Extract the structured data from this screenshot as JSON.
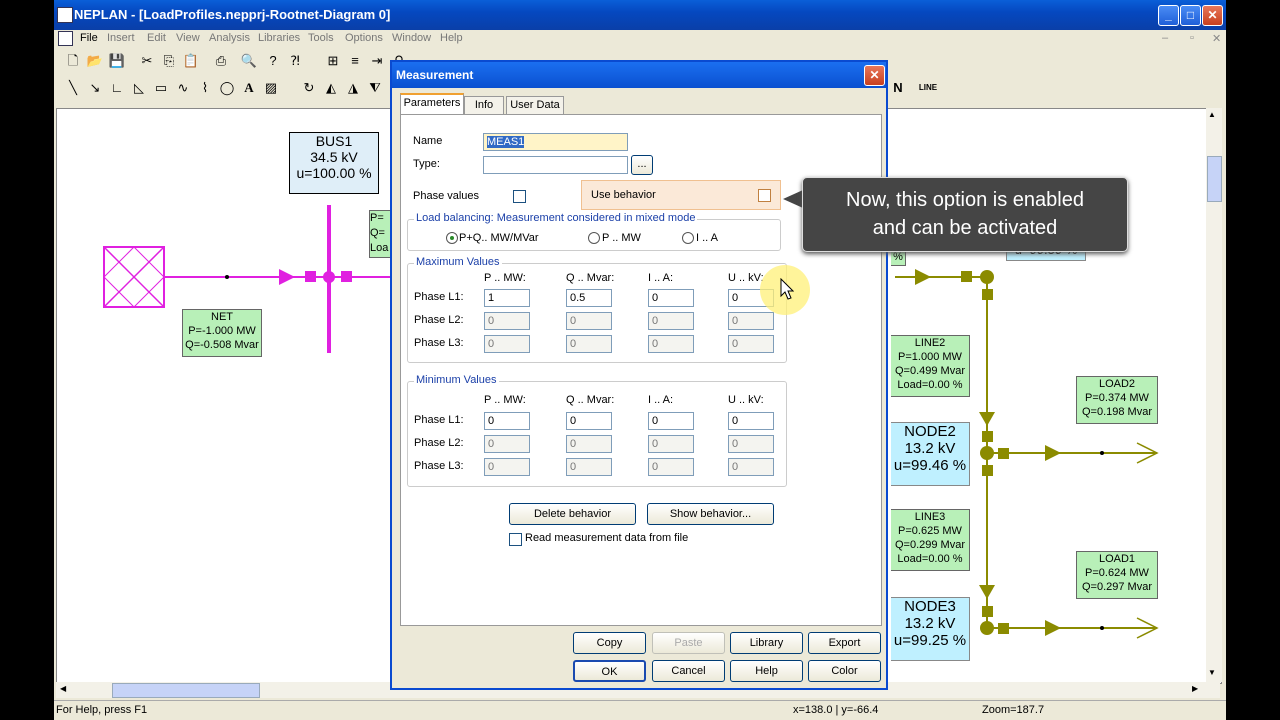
{
  "window": {
    "title": "NEPLAN - [LoadProfiles.nepprj-Rootnet-Diagram 0]"
  },
  "menu": [
    {
      "label": "File",
      "enabled": true
    },
    {
      "label": "Insert",
      "enabled": false
    },
    {
      "label": "Edit",
      "enabled": false
    },
    {
      "label": "View",
      "enabled": false
    },
    {
      "label": "Analysis",
      "enabled": false
    },
    {
      "label": "Libraries",
      "enabled": false
    },
    {
      "label": "Tools",
      "enabled": false
    },
    {
      "label": "Options",
      "enabled": false
    },
    {
      "label": "Window",
      "enabled": false
    },
    {
      "label": "Help",
      "enabled": false
    }
  ],
  "toolbar_right": {
    "info_label": "N",
    "line_label": "LINE"
  },
  "diagram": {
    "bus1": {
      "name": "BUS1",
      "voltage": "34.5 kV",
      "u": "u=100.00 %"
    },
    "net": {
      "name": "NET",
      "p": "P=-1.000 MW",
      "q": "Q=-0.508 Mvar"
    },
    "partial_label": {
      "p": "P=",
      "q": "Q=",
      "load": "Loa"
    },
    "line2": {
      "name": "LINE2",
      "p": "P=1.000 MW",
      "q": "Q=0.499 Mvar",
      "load": "Load=0.00 %"
    },
    "line3": {
      "name": "LINE3",
      "p": "P=0.625 MW",
      "q": "Q=0.299 Mvar",
      "load": "Load=0.00 %"
    },
    "node2": {
      "name": "NODE2",
      "voltage": "13.2 kV",
      "u": "u=99.46 %"
    },
    "node3": {
      "name": "NODE3",
      "voltage": "13.2 kV",
      "u": "u=99.25 %"
    },
    "node1_partial": {
      "u": "u=99.59 %"
    },
    "pct_partial": "%",
    "load2": {
      "name": "LOAD2",
      "p": "P=0.374 MW",
      "q": "Q=0.198 Mvar"
    },
    "load1": {
      "name": "LOAD1",
      "p": "P=0.624 MW",
      "q": "Q=0.297 Mvar"
    }
  },
  "status": {
    "help": "For Help, press F1",
    "coords": "x=138.0 | y=-66.4",
    "zoom": "Zoom=187.7"
  },
  "dialog": {
    "title": "Measurement",
    "tabs": [
      "Parameters",
      "Info",
      "User Data"
    ],
    "name_label": "Name",
    "name_value": "MEAS1",
    "type_label": "Type:",
    "type_value": "",
    "browse_label": "...",
    "phase_values_label": "Phase values",
    "use_behavior_label": "Use behavior",
    "load_balancing": {
      "title": "Load balancing: Measurement considered in mixed mode",
      "options": [
        "P+Q.. MW/MVar",
        "P .. MW",
        "I .. A"
      ],
      "selected": 0
    },
    "max_values": {
      "title": "Maximum Values",
      "headers": [
        "P .. MW:",
        "Q .. Mvar:",
        "I .. A:",
        "U .. kV:"
      ],
      "rows": [
        {
          "label": "Phase L1:",
          "values": [
            "1",
            "0.5",
            "0",
            "0"
          ]
        },
        {
          "label": "Phase L2:",
          "values": [
            "0",
            "0",
            "0",
            "0"
          ]
        },
        {
          "label": "Phase L3:",
          "values": [
            "0",
            "0",
            "0",
            "0"
          ]
        }
      ]
    },
    "min_values": {
      "title": "Minimum Values",
      "headers": [
        "P .. MW:",
        "Q .. Mvar:",
        "I .. A:",
        "U .. kV:"
      ],
      "rows": [
        {
          "label": "Phase L1:",
          "values": [
            "0",
            "0",
            "0",
            "0"
          ]
        },
        {
          "label": "Phase L2:",
          "values": [
            "0",
            "0",
            "0",
            "0"
          ]
        },
        {
          "label": "Phase L3:",
          "values": [
            "0",
            "0",
            "0",
            "0"
          ]
        }
      ]
    },
    "delete_behavior": "Delete behavior",
    "show_behavior": "Show behavior...",
    "read_measurement": "Read measurement data from file",
    "buttons_row1": [
      "Copy",
      "Paste",
      "Library",
      "Export"
    ],
    "buttons_row2": [
      "OK",
      "Cancel",
      "Help",
      "Color"
    ]
  },
  "tooltip": {
    "line1": "Now, this option is enabled",
    "line2": "and can be activated"
  },
  "colors": {
    "bus_magenta": "#e020e0",
    "olive": "#8b8b00",
    "title_blue": "#0a50d0"
  }
}
